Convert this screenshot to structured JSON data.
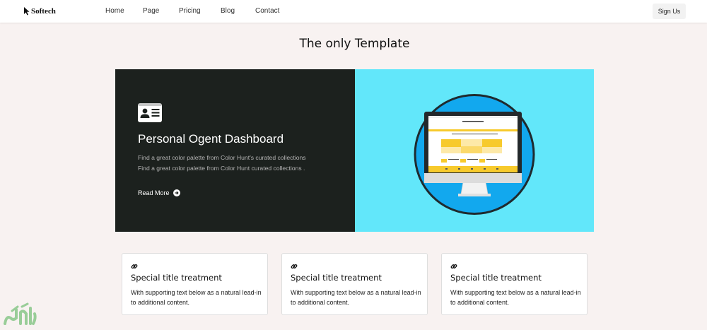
{
  "brand": {
    "name": "Softech",
    "icon": "cursor-icon"
  },
  "nav": {
    "links": [
      "Home",
      "Page",
      "Pricing",
      "Blog",
      "Contact"
    ],
    "signin_label": "Sign Us"
  },
  "section": {
    "title": "The only Template"
  },
  "hero": {
    "icon": "id-card-icon",
    "heading": "Personal Ogent Dashboard",
    "description": "Find a great color palette from Color Hunt's curated collections Find a great color palette from Color Hunt curated collections .",
    "read_more": "Read More",
    "colors": {
      "left_bg": "#1c211e",
      "right_bg": "#62e7fa",
      "circle": "#12a8ee",
      "accent": "#f7ca2c"
    }
  },
  "cards": [
    {
      "icon": "link-icon",
      "title": "Special title treatment",
      "text": "With supporting text below as a natural lead-in to additional content."
    },
    {
      "icon": "link-icon",
      "title": "Special title treatment",
      "text": "With supporting text below as a natural lead-in to additional content."
    },
    {
      "icon": "link-icon",
      "title": "Special title treatment",
      "text": "With supporting text below as a natural lead-in to additional content."
    }
  ]
}
